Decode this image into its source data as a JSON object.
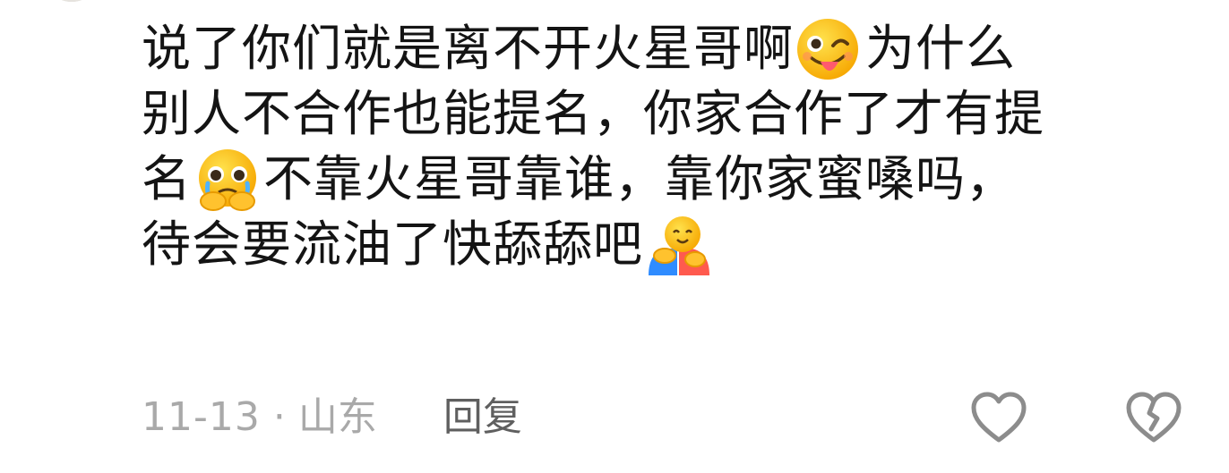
{
  "comment": {
    "line1_a": "说了你们就是离不开火星哥啊",
    "line1_b": "为什么",
    "line2": "别人不合作也能提名，你家合作了才有提",
    "line3_a": "名",
    "line3_b": "不靠火星哥靠谁，靠你家蜜嗓吗，",
    "line4": "待会要流油了快舔舔吧",
    "emojis": [
      "winking-tongue-emoji",
      "pleading-teary-emoji",
      "hugging-emoji"
    ]
  },
  "meta": {
    "date": "11-13",
    "separator": "·",
    "location": "山东",
    "reply_label": "回复"
  },
  "actions": {
    "like_icon": "heart-outline-icon",
    "dislike_icon": "broken-heart-outline-icon",
    "icon_color": "#8c8c8c"
  }
}
